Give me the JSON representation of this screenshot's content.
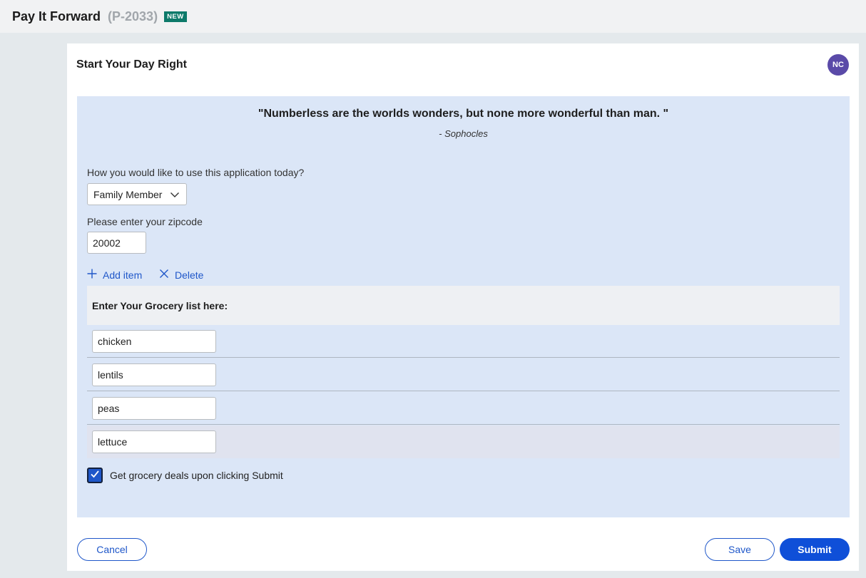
{
  "header": {
    "title": "Pay It Forward",
    "case_id": "(P-2033)",
    "badge": "NEW"
  },
  "card": {
    "title": "Start Your Day Right",
    "avatar_initials": "NC"
  },
  "quote": {
    "text": "\"Numberless are the worlds wonders, but none more wonderful than man. \"",
    "author": "- Sophocles"
  },
  "usage": {
    "label": "How you would like to use this application today?",
    "selected": "Family Member"
  },
  "zipcode": {
    "label": "Please enter your zipcode",
    "value": "20002"
  },
  "actions": {
    "add_label": "Add item",
    "delete_label": "Delete"
  },
  "grocery": {
    "header": "Enter Your Grocery list here:",
    "items": [
      "chicken",
      "lentils",
      "peas",
      "lettuce"
    ]
  },
  "deals": {
    "label": "Get grocery deals upon clicking Submit",
    "checked": true
  },
  "footer": {
    "cancel": "Cancel",
    "save": "Save",
    "submit": "Submit"
  },
  "colors": {
    "accent": "#1f57c9",
    "panel_bg": "#dbe6f7",
    "badge_bg": "#0d7a6a",
    "avatar_bg": "#5a4aa8"
  },
  "icons": {
    "add": "plus-icon",
    "delete": "close-icon",
    "dropdown": "chevron-down-icon",
    "check": "checkmark-icon"
  }
}
